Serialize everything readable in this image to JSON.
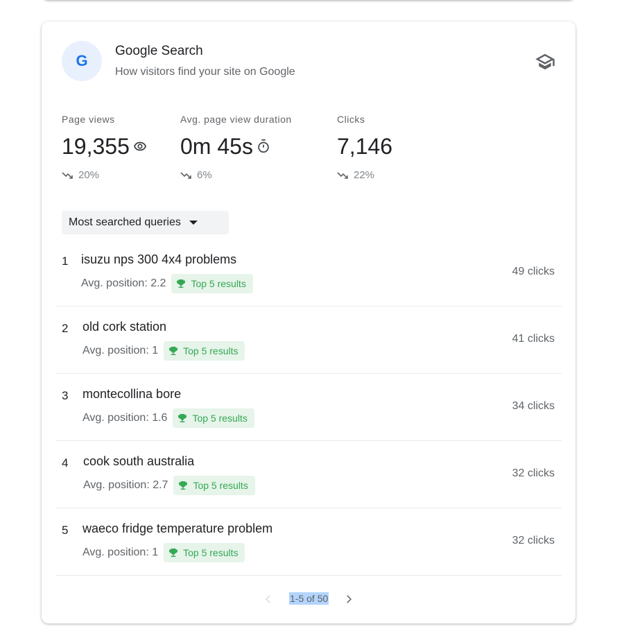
{
  "header": {
    "logo_letter": "G",
    "title": "Google Search",
    "subtitle": "How visitors find your site on Google",
    "learn_icon": "school-icon"
  },
  "metrics": [
    {
      "label": "Page views",
      "value": "19,355",
      "icon": "eye-icon",
      "trend": "20%",
      "trend_direction": "down"
    },
    {
      "label": "Avg. page view duration",
      "value": "0m 45s",
      "icon": "timer-icon",
      "trend": "6%",
      "trend_direction": "down"
    },
    {
      "label": "Clicks",
      "value": "7,146",
      "icon": "",
      "trend": "22%",
      "trend_direction": "down"
    }
  ],
  "dropdown": {
    "selected": "Most searched queries"
  },
  "queries": [
    {
      "rank": "1",
      "query": "isuzu nps 300 4x4 problems",
      "position": "Avg. position: 2.2",
      "badge": "Top 5 results",
      "clicks": "49 clicks"
    },
    {
      "rank": "2",
      "query": "old cork station",
      "position": "Avg. position: 1",
      "badge": "Top 5 results",
      "clicks": "41 clicks"
    },
    {
      "rank": "3",
      "query": "montecollina bore",
      "position": "Avg. position: 1.6",
      "badge": "Top 5 results",
      "clicks": "34 clicks"
    },
    {
      "rank": "4",
      "query": "cook south australia",
      "position": "Avg. position: 2.7",
      "badge": "Top 5 results",
      "clicks": "32 clicks"
    },
    {
      "rank": "5",
      "query": "waeco fridge temperature problem",
      "position": "Avg. position: 1",
      "badge": "Top 5 results",
      "clicks": "32 clicks"
    }
  ],
  "pagination": {
    "range": "1-5 of 50"
  },
  "colors": {
    "accent": "#1a73e8",
    "badge_bg": "#e6f4ea",
    "badge_text": "#34a853",
    "muted": "#5f6368"
  }
}
